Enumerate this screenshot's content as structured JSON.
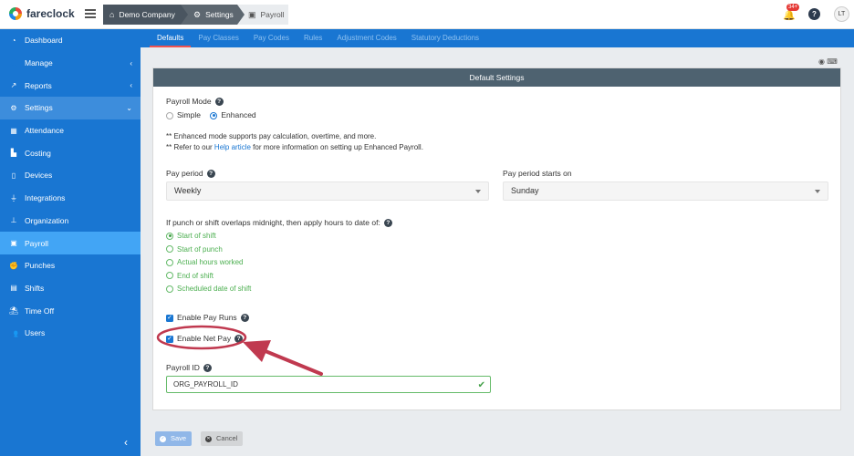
{
  "app": {
    "name": "fareclock"
  },
  "breadcrumbs": [
    "Demo Company",
    "Settings",
    "Payroll"
  ],
  "topbar": {
    "notification_count": "34+",
    "help": "?",
    "avatar_initials": "LT"
  },
  "sidebar": {
    "items": [
      {
        "label": "Dashboard",
        "icon": "dashboard-icon"
      },
      {
        "label": "Manage",
        "icon": "user-icon",
        "chevron": "‹"
      },
      {
        "label": "Reports",
        "icon": "chart-icon",
        "chevron": "‹"
      },
      {
        "label": "Settings",
        "icon": "gear-icon",
        "chevron": "⌄"
      },
      {
        "label": "Attendance",
        "icon": "calendar-icon"
      },
      {
        "label": "Costing",
        "icon": "factory-icon"
      },
      {
        "label": "Devices",
        "icon": "tablet-icon"
      },
      {
        "label": "Integrations",
        "icon": "plug-icon"
      },
      {
        "label": "Organization",
        "icon": "sitemap-icon"
      },
      {
        "label": "Payroll",
        "icon": "money-icon"
      },
      {
        "label": "Punches",
        "icon": "punch-icon"
      },
      {
        "label": "Shifts",
        "icon": "shifts-icon"
      },
      {
        "label": "Time Off",
        "icon": "beach-icon"
      },
      {
        "label": "Users",
        "icon": "users-icon"
      }
    ],
    "collapse": "‹"
  },
  "tabs": [
    "Defaults",
    "Pay Classes",
    "Pay Codes",
    "Rules",
    "Adjustment Codes",
    "Statutory Deductions"
  ],
  "panel": {
    "title": "Default Settings",
    "payroll_mode": {
      "label": "Payroll Mode",
      "options": [
        "Simple",
        "Enhanced"
      ],
      "selected": "Enhanced"
    },
    "note_line1": "** Enhanced mode supports pay calculation, overtime, and more.",
    "note_line2_pre": "** Refer to our ",
    "note_line2_link": "Help article",
    "note_line2_post": " for more information on setting up Enhanced Payroll.",
    "pay_period": {
      "label": "Pay period",
      "value": "Weekly"
    },
    "pay_period_start": {
      "label": "Pay period starts on",
      "value": "Sunday"
    },
    "overlap": {
      "label": "If punch or shift overlaps midnight, then apply hours to date of:",
      "options": [
        "Start of shift",
        "Start of punch",
        "Actual hours worked",
        "End of shift",
        "Scheduled date of shift"
      ],
      "selected": "Start of shift"
    },
    "enable_pay_runs": {
      "label": "Enable Pay Runs",
      "checked": true
    },
    "enable_net_pay": {
      "label": "Enable Net Pay",
      "checked": true
    },
    "payroll_id": {
      "label": "Payroll ID",
      "value": "ORG_PAYROLL_ID"
    }
  },
  "footer": {
    "save": "Save",
    "cancel": "Cancel"
  },
  "colors": {
    "sidebar": "#1976d2",
    "active": "#42a5f5",
    "header": "#4e6270",
    "annotation": "#c0394f"
  }
}
